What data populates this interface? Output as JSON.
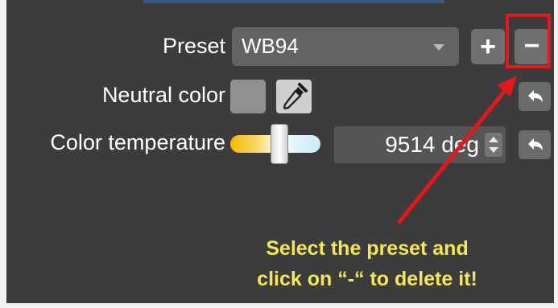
{
  "panel": {
    "preset": {
      "label": "Preset",
      "value": "WB94",
      "add_label": "+",
      "remove_label": "−"
    },
    "neutral_color": {
      "label": "Neutral color",
      "swatch_color": "#909090"
    },
    "color_temperature": {
      "label": "Color temperature",
      "value": "9514 deg",
      "slider_position": 0.55
    }
  },
  "annotation": {
    "line1": "Select the preset and",
    "line2": "click on “-“ to delete it!",
    "text_color": "#f2e75a",
    "arrow_color": "#e3171c",
    "highlight_color": "#e3171c"
  },
  "icons": {
    "dropdown": "chevron-down-icon",
    "eyedropper": "eyedropper-icon",
    "reset": "undo-arrow-icon",
    "stepper": "stepper-icon"
  }
}
